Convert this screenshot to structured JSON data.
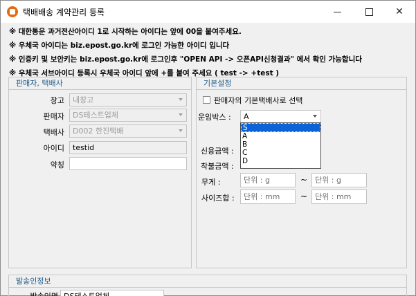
{
  "window": {
    "title": "택배배송 계약관리 등록",
    "minimize": "minimize",
    "maximize": "maximize",
    "close": "✕"
  },
  "notices": [
    "※ 대한통운 과거전산아이디 1로 시작하는 아이디는 앞에 00을 붙여주세요.",
    "※ 우체국 아이디는 biz.epost.go.kr에 로그인 가능한 아이디 입니다",
    "※ 인증키 및 보안키는 biz.epost.go.kr에 로그인후 \"OPEN API -> 오픈API신청결과\" 에서 확인 가능합니다",
    "※ 우체국 서브아이디 등록시 우체국 아이디 앞에 +를 붙여 주세요  ( test -> +test )"
  ],
  "seller_group": {
    "title": "판매자, 택배사",
    "warehouse_label": "창고",
    "warehouse_value": "내창고",
    "seller_label": "판매자",
    "seller_value": "DS테스트업체",
    "courier_label": "택배사",
    "courier_value": "D002 한진택배",
    "id_label": "아이디",
    "id_value": "testid",
    "alias_label": "약칭",
    "alias_value": ""
  },
  "basic_group": {
    "title": "기본설정",
    "default_courier_checkbox": "판매자의 기본택배사로 선택",
    "box_label": "운임박스 :",
    "box_value": "A",
    "box_options": [
      "S",
      "A",
      "B",
      "C",
      "D"
    ],
    "credit_label": "신용금액 :",
    "collect_label": "착불금액 :",
    "weight_label": "무게 :",
    "weight_from": "단위 : g",
    "weight_to": "단위 : g",
    "size_label": "사이즈합 :",
    "size_from": "단위 : mm",
    "size_to": "단위 : mm",
    "tilde": "~"
  },
  "sender_group": {
    "title": "발송인정보",
    "sender_label": "발송인명",
    "sender_value": "DS테스트업체"
  }
}
